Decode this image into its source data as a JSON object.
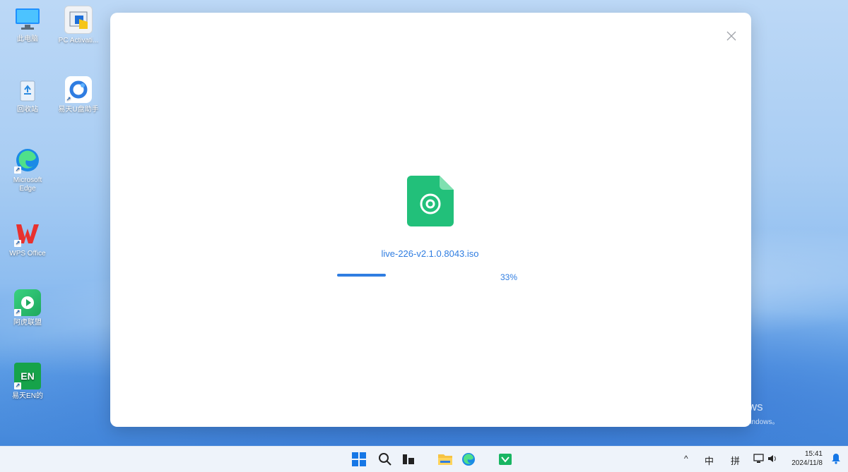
{
  "desktop": {
    "icons": [
      {
        "label": "此电脑",
        "icon": "computer-icon"
      },
      {
        "label": "PC Activati...",
        "icon": "app-window-icon"
      },
      {
        "label": "回收站",
        "icon": "recycle-bin-icon"
      },
      {
        "label": "易天U盘助手",
        "icon": "usb-helper-icon"
      },
      {
        "label": "Microsoft Edge",
        "icon": "edge-icon"
      },
      {
        "label": "WPS Office",
        "icon": "wps-icon"
      },
      {
        "label": "阿虎联盟",
        "icon": "green-app-icon"
      },
      {
        "label": "易天EN的",
        "icon": "en-app-icon"
      }
    ],
    "watermark": {
      "line1": "激活 Windows",
      "line2": "转到\"设置\"以激活 Windows。"
    }
  },
  "dialog": {
    "file_icon": "disc-image-file-icon",
    "file_name": "live-226-v2.1.0.8043.iso",
    "progress_percent_label": "33%",
    "progress_value": 0.33,
    "close_icon": "close-icon"
  },
  "taskbar": {
    "apps": [
      "start-icon",
      "search-icon",
      "task-view-icon",
      "file-explorer-icon",
      "edge-icon",
      "store-icon"
    ],
    "tray": {
      "chevron": "^",
      "ime1": "中",
      "ime2": "拼",
      "time": "15:41",
      "date": "2024/11/8"
    }
  },
  "colors": {
    "accent": "#2f7de1",
    "file_icon_green": "#22c07a"
  }
}
